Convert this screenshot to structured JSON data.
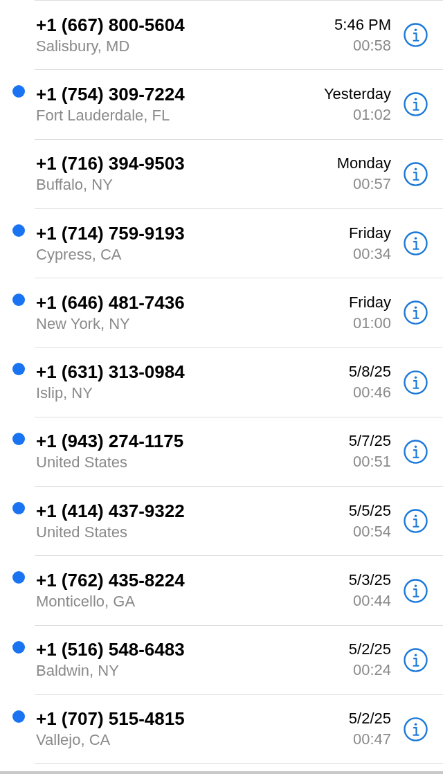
{
  "calls": [
    {
      "number": "+1 (667) 800-5604",
      "location": "Salisbury, MD",
      "when": "5:46 PM",
      "duration": "00:58",
      "unread": false
    },
    {
      "number": "+1 (754) 309-7224",
      "location": "Fort Lauderdale, FL",
      "when": "Yesterday",
      "duration": "01:02",
      "unread": true
    },
    {
      "number": "+1 (716) 394-9503",
      "location": "Buffalo, NY",
      "when": "Monday",
      "duration": "00:57",
      "unread": false
    },
    {
      "number": "+1 (714) 759-9193",
      "location": "Cypress, CA",
      "when": "Friday",
      "duration": "00:34",
      "unread": true
    },
    {
      "number": "+1 (646) 481-7436",
      "location": "New York, NY",
      "when": "Friday",
      "duration": "01:00",
      "unread": true
    },
    {
      "number": "+1 (631) 313-0984",
      "location": "Islip, NY",
      "when": "5/8/25",
      "duration": "00:46",
      "unread": true
    },
    {
      "number": "+1 (943) 274-1175",
      "location": "United States",
      "when": "5/7/25",
      "duration": "00:51",
      "unread": true
    },
    {
      "number": "+1 (414) 437-9322",
      "location": "United States",
      "when": "5/5/25",
      "duration": "00:54",
      "unread": true
    },
    {
      "number": "+1 (762) 435-8224",
      "location": "Monticello, GA",
      "when": "5/3/25",
      "duration": "00:44",
      "unread": true
    },
    {
      "number": "+1 (516) 548-6483",
      "location": "Baldwin, NY",
      "when": "5/2/25",
      "duration": "00:24",
      "unread": true
    },
    {
      "number": "+1 (707) 515-4815",
      "location": "Vallejo, CA",
      "when": "5/2/25",
      "duration": "00:47",
      "unread": true
    }
  ]
}
